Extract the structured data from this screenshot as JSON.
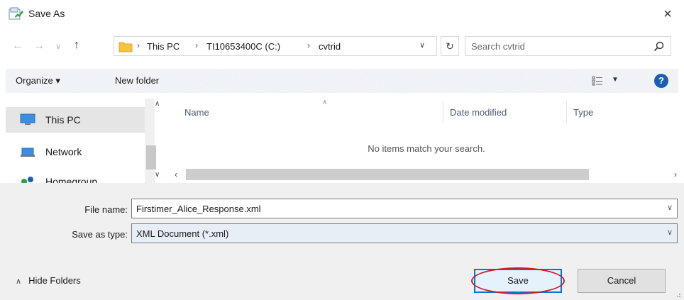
{
  "window": {
    "title": "Save As",
    "close_glyph": "×"
  },
  "address": {
    "breadcrumbs": [
      "This PC",
      "TI10653400C (C:)",
      "cvtrid"
    ],
    "separator": "›"
  },
  "search": {
    "placeholder": "Search cvtrid"
  },
  "toolbar": {
    "organize_label": "Organize ▾",
    "new_folder_label": "New folder",
    "help_glyph": "?"
  },
  "nav_pane": {
    "items": [
      {
        "label": "This PC",
        "icon": "computer-icon"
      },
      {
        "label": "Network",
        "icon": "network-icon"
      },
      {
        "label": "Homegroup",
        "icon": "homegroup-icon"
      }
    ]
  },
  "file_list": {
    "columns": [
      "Name",
      "Date modified",
      "Type"
    ],
    "empty_message": "No items match your search."
  },
  "form": {
    "file_name_label": "File name:",
    "file_name_value": "Firstimer_Alice_Response.xml",
    "save_type_label": "Save as type:",
    "save_type_value": "XML Document (*.xml)"
  },
  "footer": {
    "hide_folders_label": "Hide Folders",
    "save_label": "Save",
    "cancel_label": "Cancel"
  },
  "colors": {
    "accent": "#0078d7",
    "annotation": "#c81e2a",
    "help": "#1a5fb4"
  }
}
